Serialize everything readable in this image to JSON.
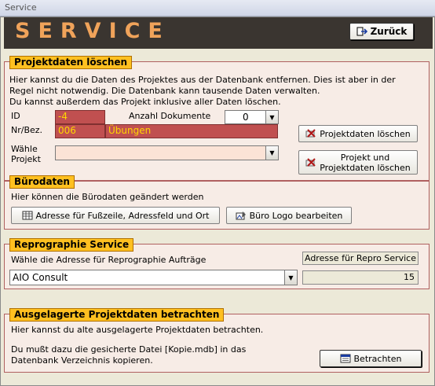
{
  "window": {
    "title": "Service"
  },
  "header": {
    "title": "SERVICE",
    "back_label": "Zurück"
  },
  "projektdaten": {
    "label": "Projektdaten löschen",
    "description_lines": [
      "Hier kannst du die Daten des Projektes aus der Datenbank entfernen. Dies ist aber in der",
      "Regel nicht notwendig. Die Datenbank kann tausende Daten verwalten.",
      "Du kannst außerdem das Projekt inklusive aller Daten löschen."
    ],
    "id_label": "ID",
    "id_value": "-4",
    "anzahl_label": "Anzahl Dokumente",
    "anzahl_value": "0",
    "nr_label": "Nr/Bez.",
    "nr_value": "006",
    "bez_value": "Übungen",
    "waehle_label_1": "Wähle",
    "waehle_label_2": "Projekt",
    "projekt_value": "",
    "delete_data_label": "Projektdaten löschen",
    "delete_project_label_1": "Projekt und",
    "delete_project_label_2": "Projektdaten löschen"
  },
  "buerodaten": {
    "label": "Bürodaten",
    "description": "Hier können die Bürodaten geändert werden",
    "address_button": "Adresse für Fußzeile, Adressfeld und Ort",
    "logo_button": "Büro Logo bearbeiten"
  },
  "repro": {
    "label": "Reprographie Service",
    "description": "Wähle die Adresse für Reprographie Aufträge",
    "address_label": "Adresse für Repro Service",
    "selected": "AIO Consult",
    "number": "15"
  },
  "archive": {
    "label": "Ausgelagerte Projektdaten betrachten",
    "line1": "Hier kannst du alte ausgelagerte Projektdaten betrachten.",
    "line2": "Du mußt dazu die gesicherte Datei [Kopie.mdb] in das",
    "line3": "Datenbank Verzeichnis kopieren.",
    "view_button": "Betrachten"
  },
  "colors": {
    "header_bg": "#3a3530",
    "header_text": "#f0a35a",
    "section_label_bg": "#ffc020",
    "field_red": "#c05050",
    "field_text": "#ffd700",
    "section_bg": "#f7ece6"
  }
}
